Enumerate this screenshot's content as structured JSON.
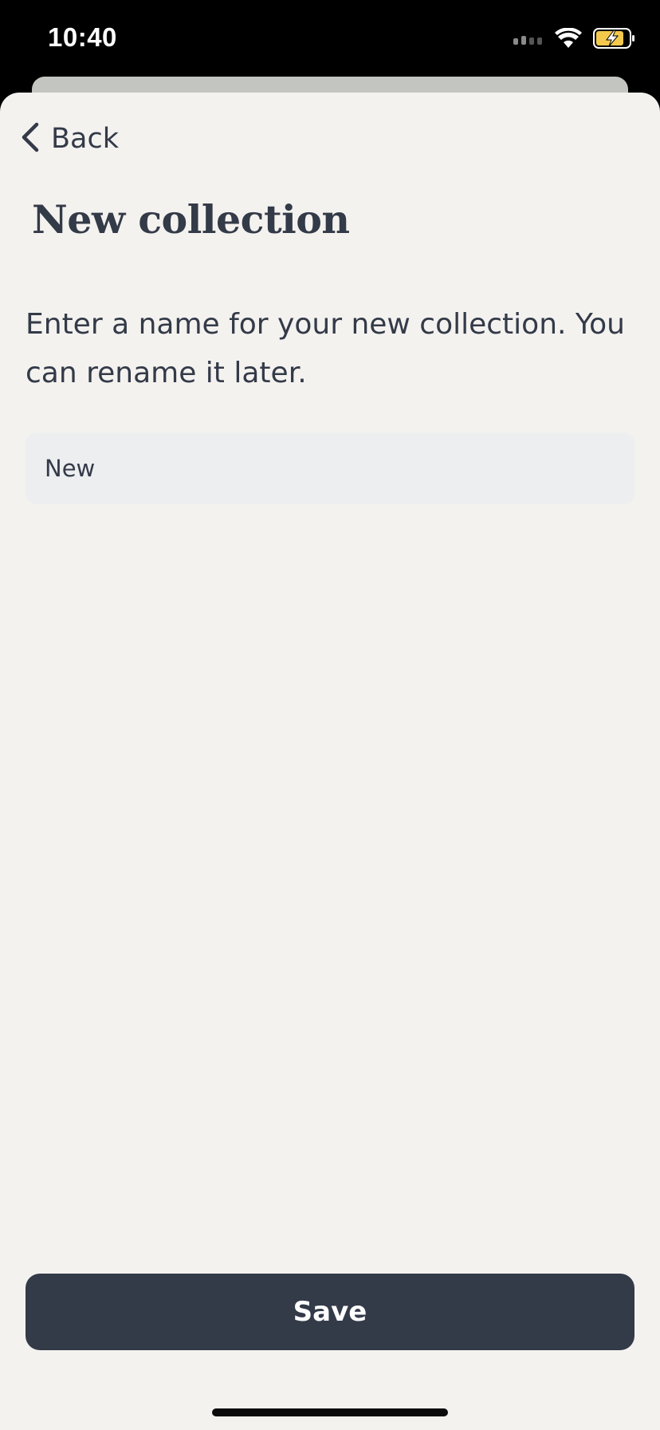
{
  "status_bar": {
    "time": "10:40",
    "icons": [
      "cellular-signal-icon",
      "wifi-icon",
      "battery-charging-icon"
    ],
    "battery_color": "#f2c94c"
  },
  "header": {
    "back_label": "Back",
    "back_icon": "chevron-left-icon"
  },
  "main": {
    "title": "New collection",
    "description": "Enter a name for your new collection. You can rename it later.",
    "name_input": {
      "value": "New",
      "placeholder": ""
    }
  },
  "footer": {
    "save_label": "Save"
  },
  "colors": {
    "text": "#333a48",
    "sheet_background": "#f4f2ef",
    "input_background": "#eceef0",
    "button_background": "#333a48"
  }
}
